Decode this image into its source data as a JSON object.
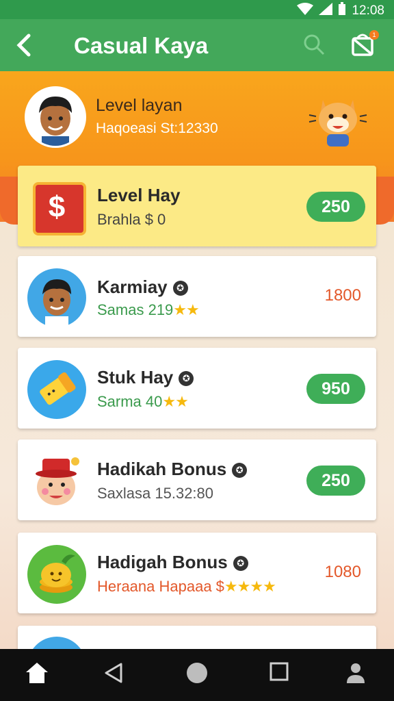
{
  "status_bar": {
    "time": "12:08"
  },
  "app_bar": {
    "back_icon": "chevron-left-icon",
    "title": "Casual Kaya",
    "search_icon": "search-icon",
    "gift_icon": "gift-icon",
    "notification_badge": "1"
  },
  "profile": {
    "name": "Level layan",
    "subtitle": "Haqoeasi St:12330"
  },
  "cards": [
    {
      "title": "Level Hay",
      "subtitle": "Brahla $ 0",
      "value": "250",
      "value_style": "pill",
      "subtitle_color": "#444444",
      "icon": "dollar-icon"
    },
    {
      "title": "Karmiay",
      "subtitle": "Samas 219",
      "stars": "★★",
      "value": "1800",
      "value_style": "plain",
      "subtitle_color": "#3a9a4c",
      "icon": "person-avatar-icon"
    },
    {
      "title": "Stuk Hay",
      "subtitle": "Sarma 40",
      "stars": "★★",
      "value": "950",
      "value_style": "pill",
      "subtitle_color": "#3a9a4c",
      "icon": "sponge-icon"
    },
    {
      "title": "Hadikah Bonus",
      "subtitle": "Saxlasa 15.32:80",
      "value": "250",
      "value_style": "pill",
      "subtitle_color": "#555555",
      "icon": "clown-icon"
    },
    {
      "title": "Hadigah Bonus",
      "subtitle": "Heraana Hapaaa $",
      "stars": "★★★★",
      "value": "1080",
      "value_style": "plain",
      "subtitle_color": "#e3582a",
      "icon": "coins-icon"
    }
  ],
  "nav": {
    "home_icon": "home-icon",
    "back_icon": "back-triangle-icon",
    "home_circle_icon": "circle-icon",
    "recents_icon": "square-icon",
    "profile_icon": "person-icon"
  }
}
